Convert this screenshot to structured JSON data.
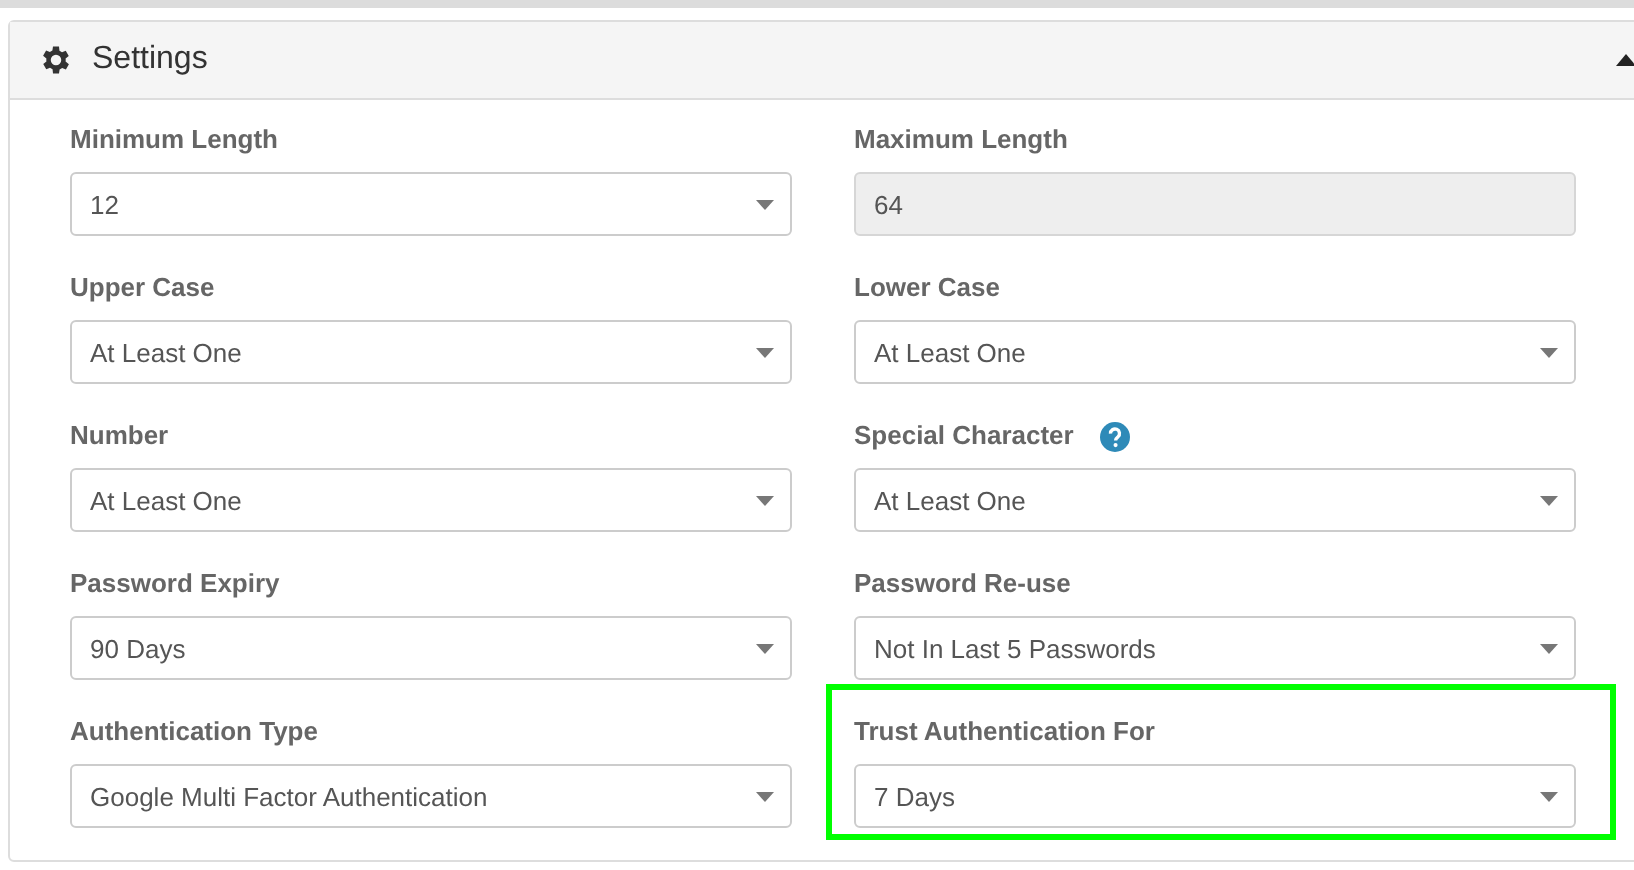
{
  "panel": {
    "title": "Settings",
    "expanded": true
  },
  "fields": [
    {
      "label": "Minimum Length",
      "value": "12",
      "kind": "select",
      "disabled": false,
      "help": false,
      "highlighted": false
    },
    {
      "label": "Maximum Length",
      "value": "64",
      "kind": "select",
      "disabled": true,
      "help": false,
      "highlighted": false
    },
    {
      "label": "Upper Case",
      "value": "At Least One",
      "kind": "select",
      "disabled": false,
      "help": false,
      "highlighted": false
    },
    {
      "label": "Lower Case",
      "value": "At Least One",
      "kind": "select",
      "disabled": false,
      "help": false,
      "highlighted": false
    },
    {
      "label": "Number",
      "value": "At Least One",
      "kind": "select",
      "disabled": false,
      "help": false,
      "highlighted": false
    },
    {
      "label": "Special Character",
      "value": "At Least One",
      "kind": "select",
      "disabled": false,
      "help": true,
      "highlighted": false
    },
    {
      "label": "Password Expiry",
      "value": "90 Days",
      "kind": "select",
      "disabled": false,
      "help": false,
      "highlighted": false
    },
    {
      "label": "Password Re-use",
      "value": "Not In Last 5 Passwords",
      "kind": "select",
      "disabled": false,
      "help": false,
      "highlighted": false
    },
    {
      "label": "Authentication Type",
      "value": "Google Multi Factor Authentication",
      "kind": "select",
      "disabled": false,
      "help": false,
      "highlighted": false
    },
    {
      "label": "Trust Authentication For",
      "value": "7 Days",
      "kind": "select",
      "disabled": false,
      "help": false,
      "highlighted": true
    }
  ]
}
